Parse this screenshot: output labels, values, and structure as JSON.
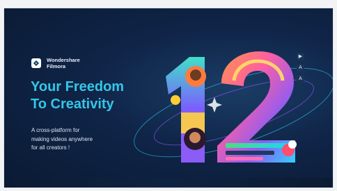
{
  "brand": {
    "line1": "Wondershare",
    "line2": "Filmora",
    "logo_icon": "filmora-diamond-icon"
  },
  "headline": {
    "line1": "Your Freedom",
    "line2": "To Creativity"
  },
  "tagline": {
    "line1": "A cross-platform for",
    "line2": "making videos anywhere",
    "line3": "for all creators !"
  },
  "art": {
    "digit1": "1",
    "digit2": "2",
    "side_icons": [
      "play-icon",
      "text-icon",
      "font-icon"
    ]
  },
  "colors": {
    "background": "#0f2447",
    "headline": "#35c6e8",
    "accent_orange": "#ff7a3d",
    "accent_purple": "#8b5cf6",
    "accent_green": "#4ade80"
  }
}
